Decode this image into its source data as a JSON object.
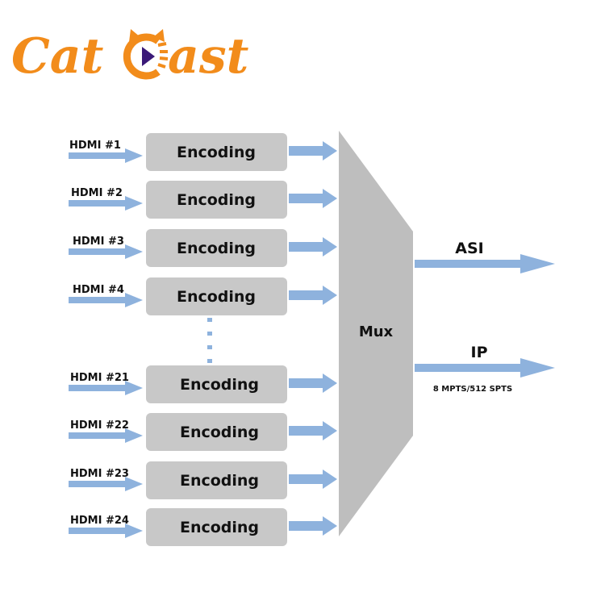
{
  "logo": {
    "text_left": "Cat",
    "text_right": "ast",
    "icon": "cat-play-icon",
    "brand_color": "#F28C1B",
    "play_color": "#3A1978"
  },
  "colors": {
    "arrow": "#8EB2DD",
    "box": "#C8C8C8",
    "mux": "#BEBEBE",
    "text": "#111111"
  },
  "inputs": [
    {
      "label": "HDMI #1",
      "block": "Encoding"
    },
    {
      "label": "HDMI #2",
      "block": "Encoding"
    },
    {
      "label": "HDMI #3",
      "block": "Encoding"
    },
    {
      "label": "HDMI #4",
      "block": "Encoding"
    },
    {
      "label": "HDMI #21",
      "block": "Encoding"
    },
    {
      "label": "HDMI #22",
      "block": "Encoding"
    },
    {
      "label": "HDMI #23",
      "block": "Encoding"
    },
    {
      "label": "HDMI #24",
      "block": "Encoding"
    }
  ],
  "mux": {
    "label": "Mux"
  },
  "outputs": [
    {
      "label": "ASI",
      "sublabel": ""
    },
    {
      "label": "IP",
      "sublabel": "8 MPTS/512 SPTS"
    }
  ]
}
